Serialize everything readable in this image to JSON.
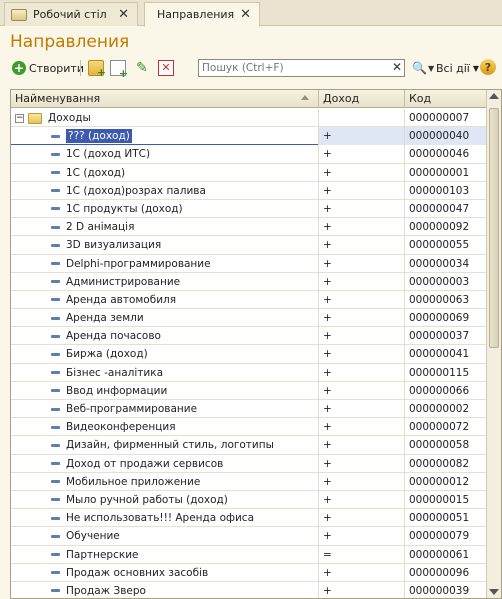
{
  "tabs": [
    {
      "label": "Робочий стіл"
    },
    {
      "label": "Направления"
    }
  ],
  "page": {
    "title": "Направления"
  },
  "toolbar": {
    "create_label": "Створити",
    "search_placeholder": "Пошук (Ctrl+F)",
    "all_actions_label": "Всі дії",
    "help_label": "?"
  },
  "grid": {
    "columns": [
      "Найменування",
      "Доход",
      "Код"
    ],
    "group": {
      "name": "Доходы",
      "income": "",
      "code": "000000007"
    },
    "rows": [
      {
        "name": "??? (доход)",
        "income": "+",
        "code": "000000040"
      },
      {
        "name": "1С (доход ИТС)",
        "income": "+",
        "code": "000000046"
      },
      {
        "name": "1С (доход)",
        "income": "+",
        "code": "000000001"
      },
      {
        "name": "1С (доход)розрах палива",
        "income": "+",
        "code": "000000103"
      },
      {
        "name": "1С продукты (доход)",
        "income": "+",
        "code": "000000047"
      },
      {
        "name": "2 D анімація",
        "income": "+",
        "code": "000000092"
      },
      {
        "name": "3D визуализация",
        "income": "+",
        "code": "000000055"
      },
      {
        "name": "Delphi-программирование",
        "income": "+",
        "code": "000000034"
      },
      {
        "name": "Администрирование",
        "income": "+",
        "code": "000000003"
      },
      {
        "name": "Аренда автомобиля",
        "income": "+",
        "code": "000000063"
      },
      {
        "name": "Аренда земли",
        "income": "+",
        "code": "000000069"
      },
      {
        "name": "Аренда почасово",
        "income": "+",
        "code": "000000037"
      },
      {
        "name": "Биржа (доход)",
        "income": "+",
        "code": "000000041"
      },
      {
        "name": "Бізнес -аналітика",
        "income": "+",
        "code": "000000115"
      },
      {
        "name": "Ввод информации",
        "income": "+",
        "code": "000000066"
      },
      {
        "name": "Веб-программирование",
        "income": "+",
        "code": "000000002"
      },
      {
        "name": "Видеоконференция",
        "income": "+",
        "code": "000000072"
      },
      {
        "name": "Дизайн, фирменный стиль, логотипы",
        "income": "+",
        "code": "000000058"
      },
      {
        "name": "Доход от продажи сервисов",
        "income": "+",
        "code": "000000082"
      },
      {
        "name": "Мобильное приложение",
        "income": "+",
        "code": "000000012"
      },
      {
        "name": "Мыло ручной работы (доход)",
        "income": "+",
        "code": "000000015"
      },
      {
        "name": "Не использовать!!! Аренда офиса",
        "income": "+",
        "code": "000000051"
      },
      {
        "name": "Обучение",
        "income": "+",
        "code": "000000079"
      },
      {
        "name": "Партнерские",
        "income": "=",
        "code": "000000061"
      },
      {
        "name": "Продаж основних засобів",
        "income": "+",
        "code": "000000096"
      },
      {
        "name": "Продаж Зверо",
        "income": "+",
        "code": "000000039"
      }
    ]
  },
  "colors": {
    "title": "#c07a00",
    "selection": "#3c5ab0"
  }
}
